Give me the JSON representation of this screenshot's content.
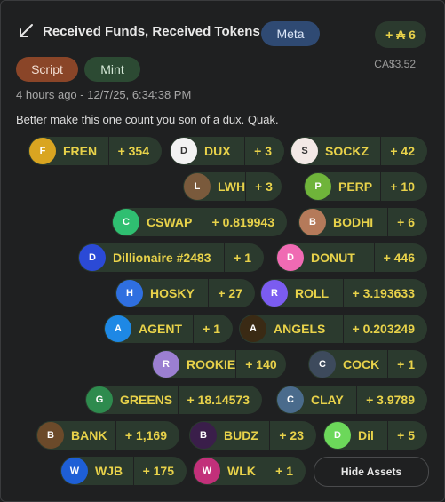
{
  "header": {
    "title": "Received Funds, Received Tokens",
    "meta_label": "Meta",
    "ada_amount": "+ ₳ 6",
    "fiat_value": "CA$3.52"
  },
  "tags": {
    "script": "Script",
    "mint": "Mint"
  },
  "timestamp": "4 hours ago - 12/7/25, 6:34:38 PM",
  "message": "Better make this one count you son of a dux. Quak.",
  "tokens": [
    {
      "name": "FREN",
      "amount": "+ 354",
      "color": "#d9a521",
      "icon": "fren-icon"
    },
    {
      "name": "DUX",
      "amount": "+ 3",
      "color": "#f2f2f2",
      "icon": "dux-icon"
    },
    {
      "name": "SOCKZ",
      "amount": "+ 42",
      "color": "#f3e9e6",
      "icon": "sockz-icon"
    },
    {
      "name": "LWH",
      "amount": "+ 3",
      "color": "#7a5a3c",
      "icon": "lwh-icon"
    },
    {
      "name": "PERP",
      "amount": "+ 10",
      "color": "#6fb43a",
      "icon": "perp-icon"
    },
    {
      "name": "CSWAP",
      "amount": "+ 0.819943",
      "color": "#2fbf71",
      "icon": "cswap-icon"
    },
    {
      "name": "BODHI",
      "amount": "+ 6",
      "color": "#b57a5a",
      "icon": "bodhi-icon"
    },
    {
      "name": "Dillionaire #2483",
      "amount": "+ 1",
      "color": "#2b4ad6",
      "icon": "dillionaire-icon"
    },
    {
      "name": "DONUT",
      "amount": "+ 446",
      "color": "#f06ab3",
      "icon": "donut-icon"
    },
    {
      "name": "HOSKY",
      "amount": "+ 27",
      "color": "#2f6fe0",
      "icon": "hosky-icon"
    },
    {
      "name": "ROLL",
      "amount": "+ 3.193633",
      "color": "#7b5cf0",
      "icon": "roll-icon"
    },
    {
      "name": "AGENT",
      "amount": "+ 1",
      "color": "#1e88e5",
      "icon": "agent-icon"
    },
    {
      "name": "ANGELS",
      "amount": "+ 0.203249",
      "color": "#3a2a14",
      "icon": "angels-icon"
    },
    {
      "name": "ROOKIE",
      "amount": "+ 140",
      "color": "#9b7fd1",
      "icon": "rookie-icon"
    },
    {
      "name": "COCK",
      "amount": "+ 1",
      "color": "#3d4a5c",
      "icon": "cock-icon"
    },
    {
      "name": "GREENS",
      "amount": "+ 18.14573",
      "color": "#2e8b4e",
      "icon": "greens-icon"
    },
    {
      "name": "CLAY",
      "amount": "+ 3.9789",
      "color": "#4a6b8c",
      "icon": "clay-icon"
    },
    {
      "name": "BANK",
      "amount": "+ 1,169",
      "color": "#6b4a2a",
      "icon": "bank-icon"
    },
    {
      "name": "BUDZ",
      "amount": "+ 23",
      "color": "#3a1e4a",
      "icon": "budz-icon"
    },
    {
      "name": "Dil",
      "amount": "+ 5",
      "color": "#6cd85a",
      "icon": "dil-icon"
    },
    {
      "name": "WJB",
      "amount": "+ 175",
      "color": "#1e5fd6",
      "icon": "wjb-icon"
    },
    {
      "name": "WLK",
      "amount": "+ 1",
      "color": "#c2307a",
      "icon": "wlk-icon"
    }
  ],
  "hide_assets_label": "Hide Assets"
}
